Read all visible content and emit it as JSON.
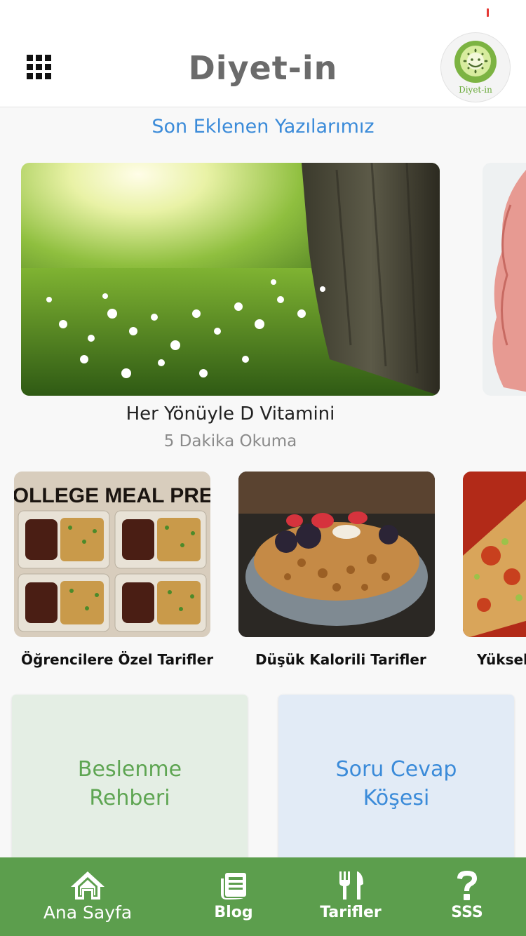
{
  "header": {
    "title": "Diyet-in",
    "logo_text": "Diyet-in",
    "menu_icon": "grid-icon"
  },
  "section": {
    "title": "Son Eklenen Yazılarımız"
  },
  "featured": {
    "title": "Her Yönüyle D Vitamini",
    "subtitle": "5 Dakika Okuma"
  },
  "recipes": {
    "items": [
      {
        "label": "Öğrencilere Özel Tarifler",
        "image_text": "COLLEGE MEAL PREP"
      },
      {
        "label": "Düşük Kalorili Tarifler"
      },
      {
        "label": "Yüksek"
      }
    ]
  },
  "tiles": [
    {
      "label": "Beslenme Rehberi"
    },
    {
      "label": "Soru Cevap Köşesi"
    }
  ],
  "nav": {
    "items": [
      {
        "label": "Ana Sayfa",
        "icon": "home-icon"
      },
      {
        "label": "Blog",
        "icon": "blog-icon"
      },
      {
        "label": "Tarifler",
        "icon": "cutlery-icon"
      },
      {
        "label": "SSS",
        "icon": "question-icon"
      }
    ]
  },
  "colors": {
    "accent_blue": "#3b8bd9",
    "accent_green": "#5c9e4d",
    "tile_green_bg": "#e4eee4",
    "tile_blue_bg": "#e2ebf6"
  }
}
